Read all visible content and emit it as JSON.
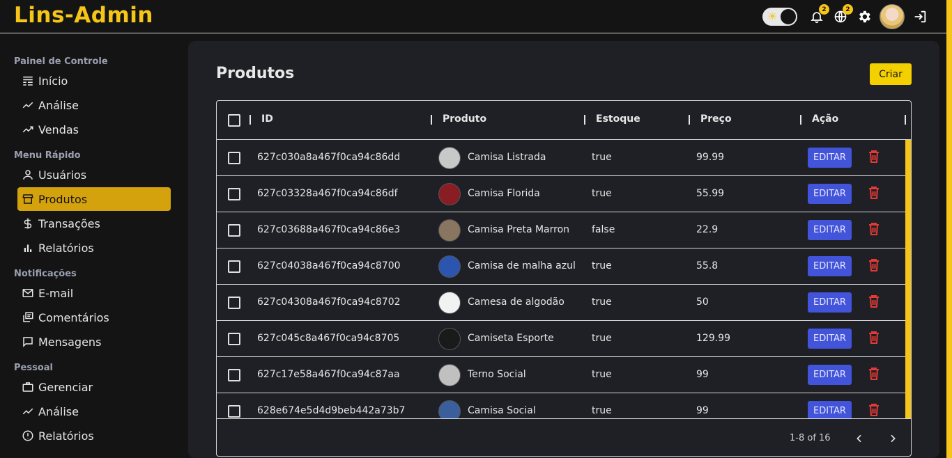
{
  "app": {
    "logo": "Lins-Admin"
  },
  "topbar": {
    "notifications_count": "2",
    "language_count": "2"
  },
  "sidebar": {
    "sections": [
      {
        "title": "Painel de Controle",
        "items": [
          {
            "label": "Início",
            "icon": "home-grid-icon"
          },
          {
            "label": "Análise",
            "icon": "trend-icon"
          },
          {
            "label": "Vendas",
            "icon": "trend-icon"
          }
        ]
      },
      {
        "title": "Menu Rápido",
        "items": [
          {
            "label": "Usuários",
            "icon": "user-icon"
          },
          {
            "label": "Produtos",
            "icon": "store-icon",
            "active": true
          },
          {
            "label": "Transações",
            "icon": "dollar-icon"
          },
          {
            "label": "Relatórios",
            "icon": "bar-chart-icon"
          }
        ]
      },
      {
        "title": "Notificações",
        "items": [
          {
            "label": "E-mail",
            "icon": "mail-icon"
          },
          {
            "label": "Comentários",
            "icon": "comments-icon"
          },
          {
            "label": "Mensagens",
            "icon": "chat-icon"
          }
        ]
      },
      {
        "title": "Pessoal",
        "items": [
          {
            "label": "Gerenciar",
            "icon": "briefcase-icon"
          },
          {
            "label": "Análise",
            "icon": "trend-icon"
          },
          {
            "label": "Relatórios",
            "icon": "info-icon"
          }
        ]
      }
    ]
  },
  "main": {
    "title": "Produtos",
    "create_label": "Criar",
    "table": {
      "columns": [
        "ID",
        "Produto",
        "Estoque",
        "Preço",
        "Ação"
      ],
      "edit_label": "EDITAR",
      "rows": [
        {
          "id": "627c030a8a467f0ca94c86dd",
          "product": "Camisa Listrada",
          "stock": "true",
          "price": "99.99",
          "thumb_color": "#c8c8c8"
        },
        {
          "id": "627c03328a467f0ca94c86df",
          "product": "Camisa Florida",
          "stock": "true",
          "price": "55.99",
          "thumb_color": "#8a1c24"
        },
        {
          "id": "627c03688a467f0ca94c86e3",
          "product": "Camisa Preta Marron",
          "stock": "false",
          "price": "22.9",
          "thumb_color": "#8a7660"
        },
        {
          "id": "627c04038a467f0ca94c8700",
          "product": "Camisa de malha azul",
          "stock": "true",
          "price": "55.8",
          "thumb_color": "#2c55b0"
        },
        {
          "id": "627c04308a467f0ca94c8702",
          "product": "Camesa de algodão",
          "stock": "true",
          "price": "50",
          "thumb_color": "#f2f2f2"
        },
        {
          "id": "627c045c8a467f0ca94c8705",
          "product": "Camiseta Esporte",
          "stock": "true",
          "price": "129.99",
          "thumb_color": "#1a1a1a"
        },
        {
          "id": "627c17e58a467f0ca94c87aa",
          "product": "Terno Social",
          "stock": "true",
          "price": "99",
          "thumb_color": "#c0c0c0"
        },
        {
          "id": "628e674e5d4d9beb442a73b7",
          "product": "Camisa Social",
          "stock": "true",
          "price": "99",
          "thumb_color": "#3a5f9c"
        }
      ]
    },
    "pagination": {
      "text": "1-8 of 16"
    }
  }
}
